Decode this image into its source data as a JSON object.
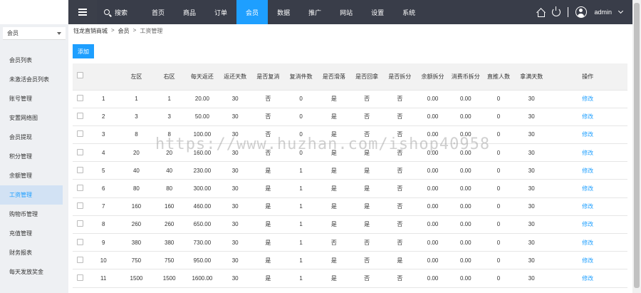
{
  "header": {
    "search_label": "搜索",
    "nav": [
      "首页",
      "商品",
      "订单",
      "会员",
      "数据",
      "推广",
      "网站",
      "设置",
      "系统"
    ],
    "active_nav": 3,
    "user": "admin"
  },
  "sidebar": {
    "module": "会员",
    "items": [
      "会员列表",
      "未激活会员列表",
      "账号管理",
      "安置网络图",
      "会员提现",
      "积分管理",
      "余额管理",
      "工资管理",
      "购物币管理",
      "充值管理",
      "财务报表",
      "每天发放奖金"
    ],
    "active_index": 7
  },
  "breadcrumb": [
    "钰龙直销商城",
    "会员",
    "工资管理"
  ],
  "toolbar": {
    "add_label": "添加"
  },
  "table": {
    "headers": [
      "",
      "",
      "左区",
      "右区",
      "每天返还",
      "返还天数",
      "是否复消",
      "复消件数",
      "是否滑落",
      "是否回拿",
      "是否拆分",
      "余额拆分",
      "消费币拆分",
      "直推人数",
      "拿满天数",
      "操作"
    ],
    "rows": [
      [
        "1",
        "1",
        "1",
        "20.00",
        "30",
        "否",
        "0",
        "是",
        "否",
        "否",
        "0.00",
        "0.00",
        "0",
        "30",
        "修改"
      ],
      [
        "2",
        "3",
        "3",
        "50.00",
        "30",
        "否",
        "0",
        "是",
        "否",
        "否",
        "0.00",
        "0.00",
        "0",
        "30",
        "修改"
      ],
      [
        "3",
        "8",
        "8",
        "100.00",
        "30",
        "否",
        "0",
        "是",
        "否",
        "否",
        "0.00",
        "0.00",
        "0",
        "30",
        "修改"
      ],
      [
        "4",
        "20",
        "20",
        "160.00",
        "30",
        "否",
        "0",
        "是",
        "是",
        "否",
        "0.00",
        "0.00",
        "0",
        "30",
        "修改"
      ],
      [
        "5",
        "40",
        "40",
        "230.00",
        "30",
        "是",
        "1",
        "是",
        "是",
        "否",
        "0.00",
        "0.00",
        "0",
        "30",
        "修改"
      ],
      [
        "6",
        "80",
        "80",
        "300.00",
        "30",
        "是",
        "1",
        "是",
        "是",
        "否",
        "0.00",
        "0.00",
        "0",
        "30",
        "修改"
      ],
      [
        "7",
        "160",
        "160",
        "460.00",
        "30",
        "是",
        "1",
        "是",
        "是",
        "否",
        "0.00",
        "0.00",
        "0",
        "30",
        "修改"
      ],
      [
        "8",
        "260",
        "260",
        "650.00",
        "30",
        "是",
        "1",
        "是",
        "是",
        "否",
        "0.00",
        "0.00",
        "0",
        "30",
        "修改"
      ],
      [
        "9",
        "380",
        "380",
        "730.00",
        "30",
        "是",
        "1",
        "否",
        "否",
        "否",
        "0.00",
        "0.00",
        "0",
        "30",
        "修改"
      ],
      [
        "10",
        "750",
        "750",
        "950.00",
        "30",
        "是",
        "1",
        "是",
        "否",
        "是",
        "0.00",
        "0.00",
        "0",
        "30",
        "修改"
      ],
      [
        "11",
        "1500",
        "1500",
        "1600.00",
        "30",
        "是",
        "1",
        "是",
        "否",
        "否",
        "0.00",
        "0.00",
        "0",
        "30",
        "修改"
      ]
    ]
  },
  "watermark": "https://www.huzhan.com/ishop40958",
  "colors": {
    "accent": "#1e9fff",
    "topbar": "#393d49",
    "sidebar": "#eef0f3"
  }
}
